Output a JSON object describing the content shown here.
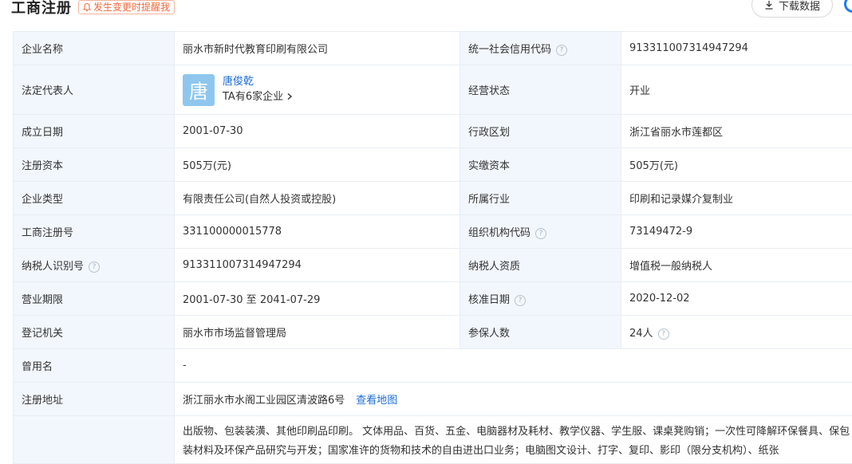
{
  "header": {
    "title": "工商注册",
    "remind_label": "发生变更时提醒我",
    "download_label": "下载数据"
  },
  "rows": {
    "r1": {
      "k1": "企业名称",
      "v1": "丽水市新时代教育印刷有限公司",
      "k2": "统一社会信用代码",
      "v2": "913311007314947294"
    },
    "r2": {
      "k1": "法定代表人",
      "avatar_char": "唐",
      "person_name": "唐俊乾",
      "person_sub": "TA有6家企业",
      "k2": "经营状态",
      "v2": "开业"
    },
    "r3": {
      "k1": "成立日期",
      "v1": "2001-07-30",
      "k2": "行政区划",
      "v2": "浙江省丽水市莲都区"
    },
    "r4": {
      "k1": "注册资本",
      "v1": "505万(元)",
      "k2": "实缴资本",
      "v2": "505万(元)"
    },
    "r5": {
      "k1": "企业类型",
      "v1": "有限责任公司(自然人投资或控股)",
      "k2": "所属行业",
      "v2": "印刷和记录媒介复制业"
    },
    "r6": {
      "k1": "工商注册号",
      "v1": "331100000015778",
      "k2": "组织机构代码",
      "v2": "73149472-9"
    },
    "r7": {
      "k1": "纳税人识别号",
      "v1": "913311007314947294",
      "k2": "纳税人资质",
      "v2": "增值税一般纳税人"
    },
    "r8": {
      "k1": "营业期限",
      "v1": "2001-07-30 至 2041-07-29",
      "k2": "核准日期",
      "v2": "2020-12-02"
    },
    "r9": {
      "k1": "登记机关",
      "v1": "丽水市市场监督管理局",
      "k2": "参保人数",
      "v2": "24人"
    },
    "r10": {
      "k1": "曾用名",
      "v1": "-"
    },
    "r11": {
      "k1": "注册地址",
      "v1": "浙江丽水市水阁工业园区清波路6号",
      "link": "查看地图"
    },
    "r12": {
      "k1": "",
      "v1": "出版物、包装装潢、其他印刷品印刷。 文体用品、百货、五金、电脑器材及耗材、教学仪器、学生服、课桌凳购销；一次性可降解环保餐具、保包装材料及环保产品研究与开发；国家准许的货物和技术的自由进出口业务；电脑图文设计、打字、复印、影印（限分支机构）、纸张"
    }
  },
  "colors": {
    "key_bg": "#f2f7fd",
    "border": "#e8edf3",
    "link": "#1c6cd8",
    "accent_orange": "#f26a3d"
  }
}
